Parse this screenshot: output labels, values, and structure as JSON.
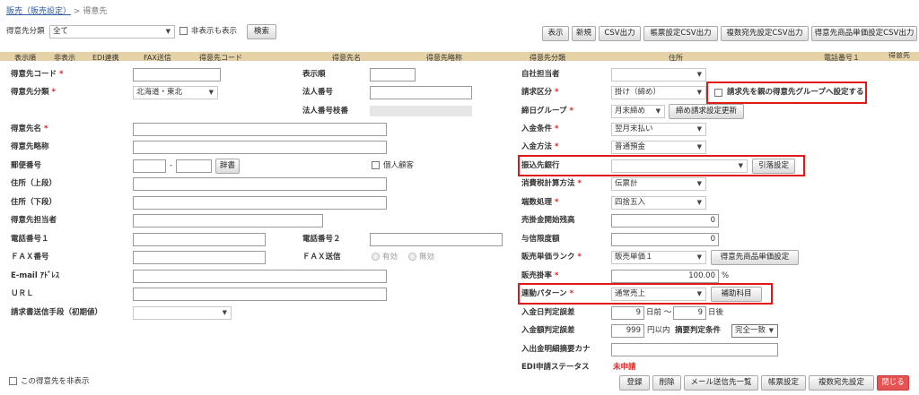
{
  "breadcrumb": {
    "parent": "販売（販売設定）",
    "sep": ">",
    "current": "得意先"
  },
  "filter": {
    "label": "得意先分類",
    "value": "全て",
    "show_hidden_label": "非表示も表示",
    "search_label": "検索"
  },
  "toolbar": [
    "表示",
    "新規",
    "CSV出力",
    "帳票設定CSV出力",
    "複数宛先設定CSV出力",
    "得意先商品単価設定CSV出力"
  ],
  "table_header": [
    "表示順",
    "非表示",
    "EDI連携",
    "FAX送信",
    "得意先コード",
    "得意先名",
    "得意先略称",
    "得意先分類",
    "住所",
    "電話番号１",
    "得意先"
  ],
  "left": {
    "code": "得意先コード",
    "category": "得意先分類",
    "category_value": "北海道・東北",
    "name": "得意先名",
    "short_name": "得意先略称",
    "zip": "郵便番号",
    "dict_btn": "辞書",
    "personal": "個人顧客",
    "addr1": "住所（上段）",
    "addr2": "住所（下段）",
    "contact": "得意先担当者",
    "tel1": "電話番号１",
    "fax": "ＦＡＸ番号",
    "email": "E-mail ｱﾄﾞﾚｽ",
    "url": "ＵＲＬ",
    "invoice_method": "請求書送信手段（初期値）",
    "hide_label": "この得意先を非表示"
  },
  "mid": {
    "display_order": "表示順",
    "corp_no": "法人番号",
    "corp_branch": "法人番号枝番",
    "tel2": "電話番号２",
    "fax_send": "ＦＡＸ送信",
    "valid": "有効",
    "invalid": "無効"
  },
  "right": {
    "staff": "自社担当者",
    "billing_type": "請求区分",
    "billing_type_value": "掛け（締め）",
    "parent_group_label": "請求先を親の得意先グループへ設定する",
    "closing_group": "締日グループ",
    "closing_group_value": "月末締め",
    "closing_btn": "締め請求設定更新",
    "payment_cond": "入金条件",
    "payment_cond_value": "翌月末払い",
    "payment_method": "入金方法",
    "payment_method_value": "普通預金",
    "bank": "振込先銀行",
    "bank_btn": "引落設定",
    "tax_calc": "消費税計算方法",
    "tax_calc_value": "伝票計",
    "rounding": "端数処理",
    "rounding_value": "四捨五入",
    "ar_start": "売掛金開始残高",
    "ar_start_value": "0",
    "credit": "与信限度額",
    "credit_value": "0",
    "price_rank": "販売単価ランク",
    "price_rank_value": "販売単価１",
    "price_rank_btn": "得意先商品単価設定",
    "rate": "販売掛率",
    "rate_value": "100.00",
    "rate_unit": "%",
    "link_pattern": "連動パターン",
    "link_pattern_value": "通常売上",
    "link_btn": "補助科目",
    "date_tol": "入金日判定誤差",
    "date_before": "9",
    "date_before_unit": "日前 ～",
    "date_after": "9",
    "date_after_unit": "日後",
    "amount_tol": "入金額判定誤差",
    "amount_value": "999",
    "amount_unit": "円以内",
    "summary_cond": "摘要判定条件",
    "summary_cond_value": "完全一致",
    "kana": "入出金明細摘要カナ",
    "edi_status": "EDI申請ステータス",
    "edi_status_value": "未申請"
  },
  "bottom_buttons": [
    "登録",
    "削除",
    "メール送信先一覧",
    "帳票設定",
    "複数宛先設定",
    "閉じる"
  ],
  "required_mark": "*"
}
